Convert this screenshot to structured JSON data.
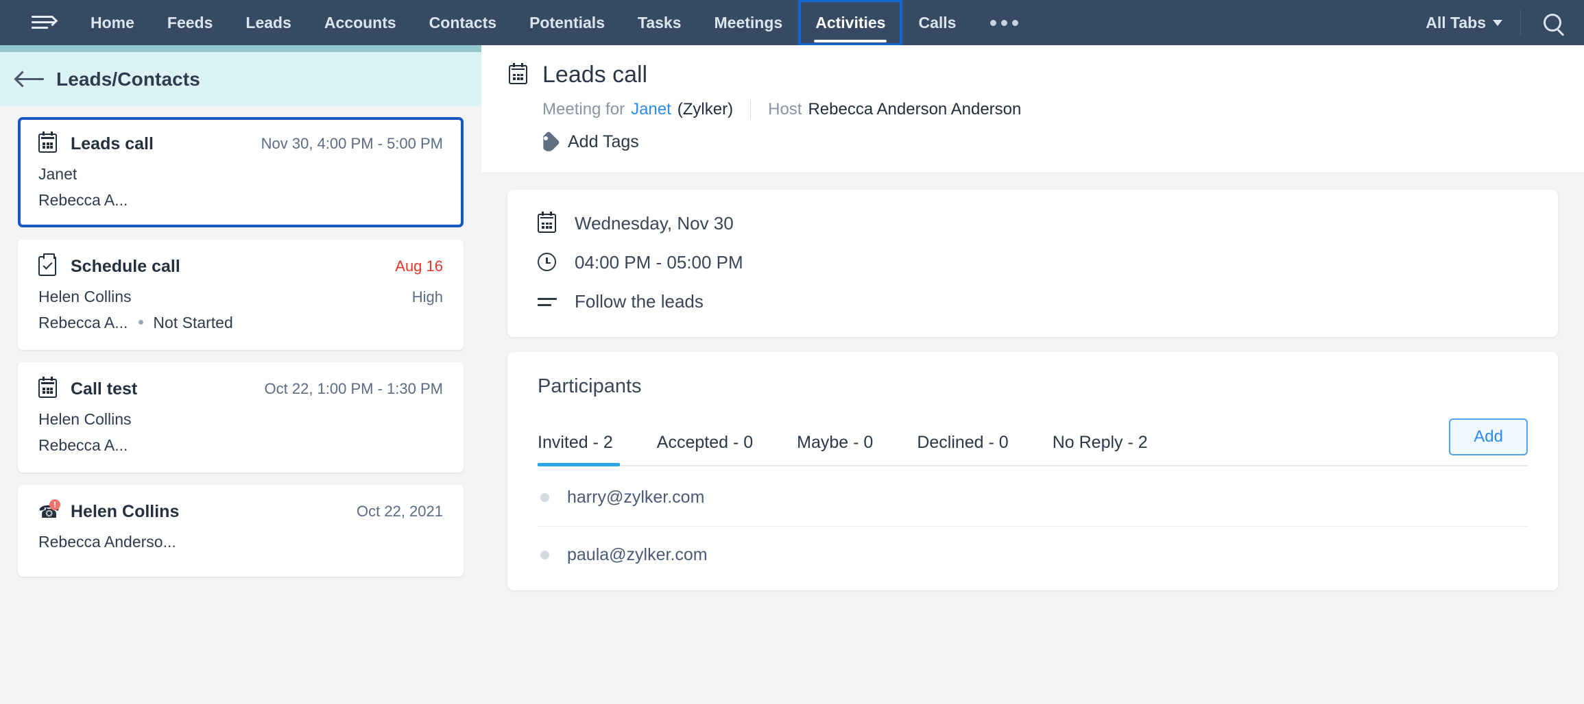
{
  "topnav": {
    "menu_icon": "menu-arrow-icon",
    "items": [
      {
        "label": "Home",
        "active": false
      },
      {
        "label": "Feeds",
        "active": false
      },
      {
        "label": "Leads",
        "active": false
      },
      {
        "label": "Accounts",
        "active": false
      },
      {
        "label": "Contacts",
        "active": false
      },
      {
        "label": "Potentials",
        "active": false
      },
      {
        "label": "Tasks",
        "active": false
      },
      {
        "label": "Meetings",
        "active": false
      },
      {
        "label": "Activities",
        "active": true
      },
      {
        "label": "Calls",
        "active": false
      }
    ],
    "more_icon": "ellipsis-icon",
    "all_tabs_label": "All Tabs",
    "search_icon": "search-icon",
    "bar_color": "#374a63",
    "focus_outline_color": "#1464d6",
    "accent_strip_color": "#93c8cf"
  },
  "sidebar": {
    "back_icon": "back-arrow-icon",
    "title": "Leads/Contacts",
    "header_bg": "#dcf3f6",
    "cards": [
      {
        "icon": "calendar-icon",
        "type": "meeting",
        "title": "Leads call",
        "meta": "Nov 30, 4:00 PM - 5:00 PM",
        "meta_urgent": false,
        "line2": "Janet",
        "line2_side": "",
        "line3": "Rebecca A...",
        "line3_status": "",
        "selected": true
      },
      {
        "icon": "task-clipboard-check-icon",
        "type": "task",
        "title": "Schedule call",
        "meta": "Aug 16",
        "meta_urgent": true,
        "line2": "Helen Collins",
        "line2_side": "High",
        "line3": "Rebecca A...",
        "line3_status": "Not Started",
        "selected": false
      },
      {
        "icon": "calendar-icon",
        "type": "meeting",
        "title": "Call test",
        "meta": "Oct 22, 1:00 PM - 1:30 PM",
        "meta_urgent": false,
        "line2": "Helen Collins",
        "line2_side": "",
        "line3": "Rebecca A...",
        "line3_status": "",
        "selected": false
      },
      {
        "icon": "phone-alert-icon",
        "type": "call",
        "title": "Helen Collins",
        "meta": "Oct 22, 2021",
        "meta_urgent": false,
        "line2": "Rebecca Anderso...",
        "line2_side": "",
        "line3": "",
        "line3_status": "",
        "selected": false
      }
    ],
    "selected_border_color": "#1559c0",
    "urgent_color": "#e8352a"
  },
  "record": {
    "icon": "calendar-icon",
    "title": "Leads call",
    "meeting_for_label": "Meeting for",
    "meeting_for_name": "Janet",
    "meeting_for_account": "(Zylker)",
    "host_label": "Host",
    "host_name": "Rebecca Anderson Anderson",
    "tags_icon": "tag-icon",
    "tags_label": "Add Tags",
    "link_color": "#2d8cf0"
  },
  "details": {
    "date_icon": "calendar-icon",
    "date": "Wednesday, Nov 30",
    "time_icon": "clock-icon",
    "time": "04:00 PM - 05:00 PM",
    "description_icon": "description-lines-icon",
    "description": "Follow the leads"
  },
  "participants": {
    "heading": "Participants",
    "tabs": [
      {
        "label": "Invited - 2",
        "active": true
      },
      {
        "label": "Accepted - 0",
        "active": false
      },
      {
        "label": "Maybe - 0",
        "active": false
      },
      {
        "label": "Declined - 0",
        "active": false
      },
      {
        "label": "No Reply - 2",
        "active": false
      }
    ],
    "add_label": "Add",
    "active_tab_color": "#29a3ec",
    "list": [
      {
        "email": "harry@zylker.com"
      },
      {
        "email": "paula@zylker.com"
      }
    ]
  }
}
